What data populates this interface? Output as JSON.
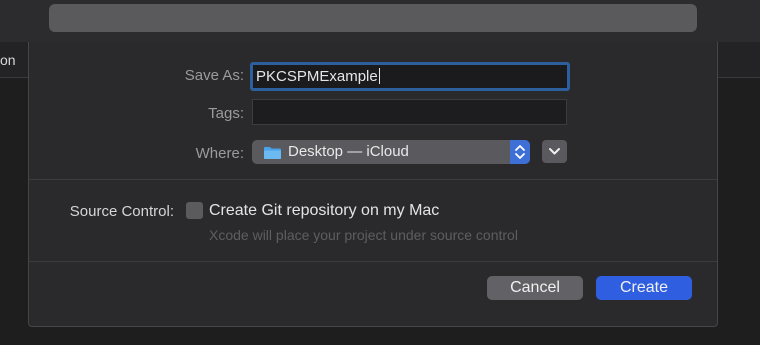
{
  "toolbar": {
    "search_placeholder": ""
  },
  "background": {
    "partial_text": "on"
  },
  "dialog": {
    "save_as": {
      "label": "Save As:",
      "value": "PKCSPMExample"
    },
    "tags": {
      "label": "Tags:",
      "value": ""
    },
    "where": {
      "label": "Where:",
      "value": "Desktop — iCloud",
      "icon": "folder-icon"
    },
    "source_control": {
      "label": "Source Control:",
      "checkbox_label": "Create Git repository on my Mac",
      "checked": false,
      "hint": "Xcode will place your project under source control"
    },
    "buttons": {
      "cancel": "Cancel",
      "create": "Create"
    }
  },
  "colors": {
    "accent": "#2f5fe0",
    "focus_ring": "#2c5f9e",
    "background": "#2a2a2c"
  }
}
